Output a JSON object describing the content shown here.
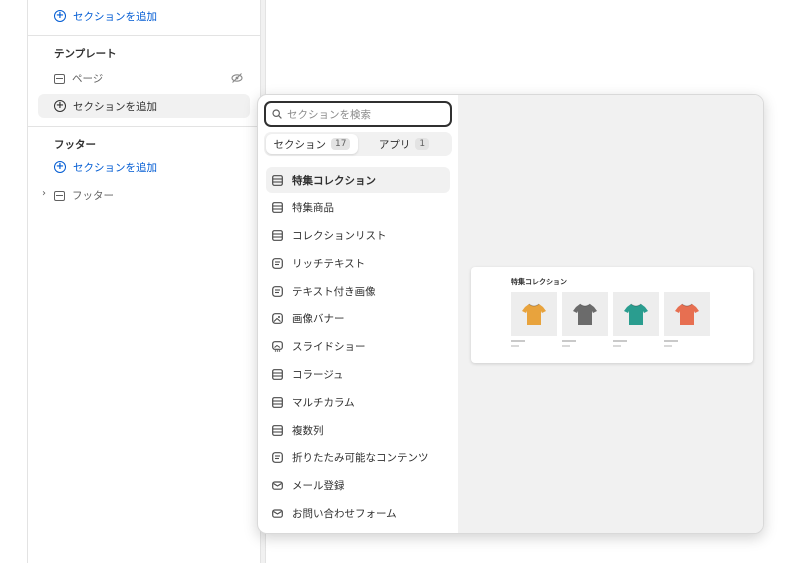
{
  "sidebar": {
    "add_section_label": "セクションを追加",
    "template_group": {
      "title": "テンプレート",
      "page_item": "ページ"
    },
    "footer_group": {
      "title": "フッター",
      "footer_item": "フッター"
    }
  },
  "popover": {
    "search": {
      "placeholder": "セクションを検索"
    },
    "tabs": [
      {
        "label": "セクション",
        "count": "17"
      },
      {
        "label": "アプリ",
        "count": "1"
      }
    ],
    "sections": [
      {
        "label": "特集コレクション",
        "icon": "layout-rows-icon"
      },
      {
        "label": "特集商品",
        "icon": "layout-rows-icon"
      },
      {
        "label": "コレクションリスト",
        "icon": "layout-rows-icon"
      },
      {
        "label": "リッチテキスト",
        "icon": "text-block-icon"
      },
      {
        "label": "テキスト付き画像",
        "icon": "text-block-icon"
      },
      {
        "label": "画像バナー",
        "icon": "image-icon"
      },
      {
        "label": "スライドショー",
        "icon": "slideshow-icon"
      },
      {
        "label": "コラージュ",
        "icon": "layout-rows-icon"
      },
      {
        "label": "マルチカラム",
        "icon": "layout-rows-icon"
      },
      {
        "label": "複数列",
        "icon": "layout-rows-icon"
      },
      {
        "label": "折りたたみ可能なコンテンツ",
        "icon": "text-block-icon"
      },
      {
        "label": "メール登録",
        "icon": "email-icon"
      },
      {
        "label": "お問い合わせフォーム",
        "icon": "email-icon"
      }
    ],
    "preview": {
      "title": "特集コレクション",
      "product_colors": [
        "#e8a33d",
        "#6b6b6b",
        "#2a9d8f",
        "#e76f51"
      ]
    }
  },
  "colors": {
    "accent": "#005bd3",
    "text": "#303030",
    "subdued": "#616161",
    "surface": "#f1f1f1"
  }
}
